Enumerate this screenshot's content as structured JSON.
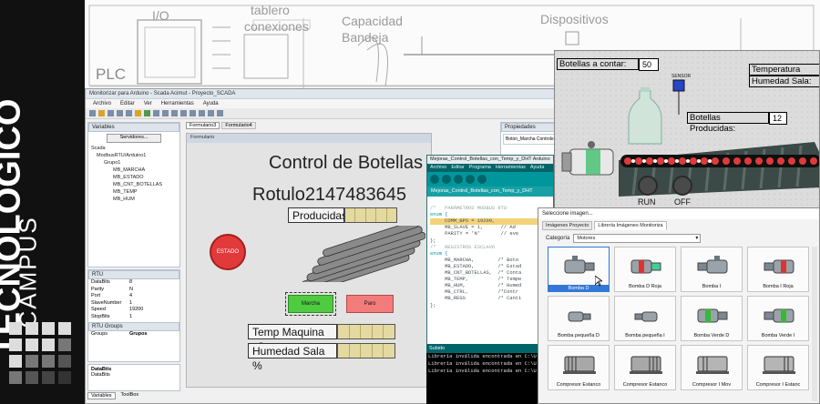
{
  "brand": {
    "line1": "CAMPUS",
    "line2": "TECNOLÓGICO"
  },
  "schematic": {
    "io": "I/O",
    "tablero": "tablero",
    "conexiones": "conexiones",
    "capacidad": "Capacidad",
    "bandeja": "Bandeja",
    "dispositivos": "Dispositivos",
    "plc": "PLC"
  },
  "ide": {
    "title": "Monitorizar para Arduino - Scada Acimut - Proyecto_SCADA",
    "menu": [
      "Archivo",
      "Editar",
      "Ver",
      "Herramientas",
      "Ayuda"
    ],
    "variables_header": "Variables",
    "servers_button": "Servidores...",
    "tree": {
      "root": "Scada",
      "device": "ModbusRTU/Arduino1",
      "group": "Grupo1",
      "vars": [
        "MB_MARCHA",
        "MB_ESTADO",
        "MB_CNT_BOTELLAS",
        "MB_TEMP",
        "MB_HUM"
      ]
    },
    "rtu_header": "RTU",
    "rtu_props": [
      {
        "k": "DataBits",
        "v": "8"
      },
      {
        "k": "Parity",
        "v": "N"
      },
      {
        "k": "Port",
        "v": "4"
      },
      {
        "k": "SlaveNumber",
        "v": "1"
      },
      {
        "k": "Speed",
        "v": "19200"
      },
      {
        "k": "StopBits",
        "v": "1"
      }
    ],
    "rtu_groups_header": "RTU Groups",
    "groups": {
      "k": "Groups",
      "v": "Grupos"
    },
    "databits_title": "DataBits",
    "databits_desc": "DataBits",
    "bottom_tabs": [
      "Variables",
      "ToolBox"
    ],
    "doc_tabs": [
      "Formulario3",
      "Formulario4"
    ],
    "form_title": "Formulario",
    "properties_header": "Propiedades",
    "properties_obj": "Boton_Marcha Controles.B"
  },
  "form": {
    "title": "Control de Botellas",
    "rotulo": "Rotulo2147483645",
    "producidas": "Producidas",
    "estado": "ESTADO",
    "marcha": "Marcha",
    "paro": "Paro",
    "temp": "Temp Maquina °C",
    "humedad": "Humedad Sala %",
    "colors": {
      "estado": "#e23a3a",
      "marcha": "#4ecb3f",
      "paro": "#f27c7c",
      "indicator": "#e4d9a0"
    }
  },
  "arduino": {
    "title": "Mejoras_Control_Botellas_con_Temp_y_DHT Arduino",
    "menu": [
      "Archivo",
      "Editar",
      "Programa",
      "Herramientas",
      "Ayuda"
    ],
    "tab": "Mejoras_Control_Botellas_con_Temp_y_DHT",
    "code": [
      "/*   PARÁMETROS MODBUS RTU",
      "",
      "enum {",
      "     COMM_BPS = 19200,",
      "     MB_SLAVE = 1,      // Ad",
      "     PARITY = 'N'       // eve",
      "};",
      "",
      "/*   REGISTROS ESCLAVO",
      "",
      "enum {",
      "     MB_MARCHA,        /* Boto",
      "     MB_ESTADO,        /* Estad",
      "     MB_CNT_BOTELLAS,  /* Conta",
      "     MB_TEMP,          /* Tempe",
      "     MB_HUM,           /* Humed",
      "     MB_CTRL,          /*Contr",
      "     MB_REGS           /* Canti",
      "};"
    ],
    "console_header": "Subido",
    "console": [
      "Librería inválida encontrada en C:\\U",
      "Librería inválida encontrada en C:\\U",
      "Librería inválida encontrada en C:\\U"
    ]
  },
  "sim": {
    "to_count_label": "Botellas a contar:",
    "to_count_value": "50",
    "sensor": "SENSOR",
    "temp_label": "Temperatura Sala",
    "hum_label": "Humedad Sala:",
    "produced_label": "Botellas Producidas:",
    "produced_value": "12",
    "run": "RUN",
    "off": "OFF"
  },
  "dialog": {
    "title": "Seleccione imagen...",
    "tabs": [
      "Imágenes Proyecto",
      "Librería Imágenes Monitoriza"
    ],
    "category_label": "Categoría",
    "category_value": "Motores",
    "items": [
      "Bomba D",
      "Bomba D Roja",
      "Bomba I",
      "Bomba I Roja",
      "Bomba pequeña D",
      "Bomba pequeña I",
      "Bomba Verde D",
      "Bomba Verde I",
      "Compresor Estanco",
      "Compresor Estanco",
      "Compresor I Mov",
      "Compresor I Estanc"
    ],
    "selected_index": 0
  }
}
